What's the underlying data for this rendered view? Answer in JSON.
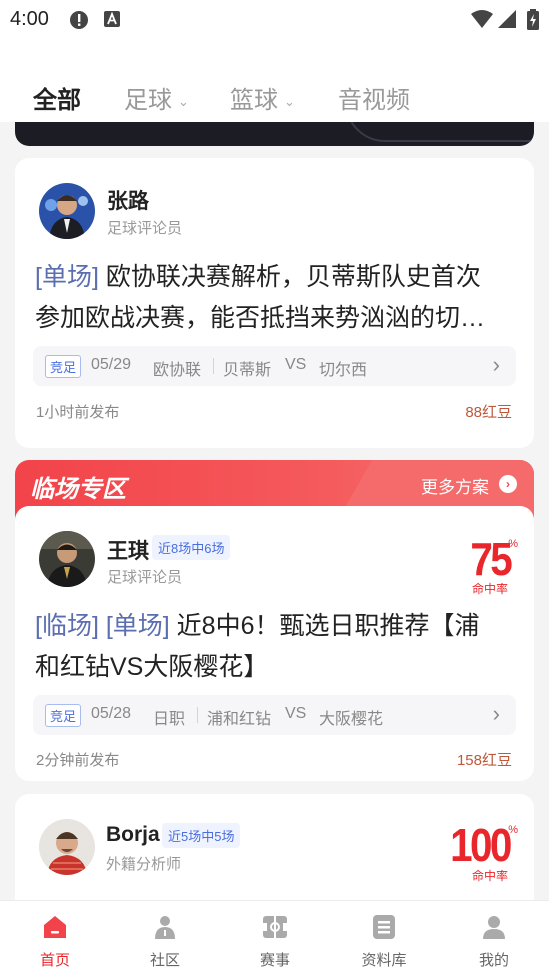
{
  "status_bar": {
    "time": "4:00"
  },
  "tabs": [
    {
      "label": "全部",
      "active": true,
      "has_dropdown": false
    },
    {
      "label": "足球",
      "active": false,
      "has_dropdown": true
    },
    {
      "label": "篮球",
      "active": false,
      "has_dropdown": true
    },
    {
      "label": "音视频",
      "active": false,
      "has_dropdown": false
    }
  ],
  "card1": {
    "name": "张路",
    "role": "足球评论员",
    "headline_tag": "[单场]",
    "headline_line1": " 欧协联决赛解析，贝蒂斯队史首次",
    "headline_line2": "参加欧战决赛，能否抵挡来势汹汹的切…",
    "match": {
      "kind": "竞足",
      "date": "05/29",
      "league": "欧协联",
      "home": "贝蒂斯",
      "vs": "VS",
      "away": "切尔西"
    },
    "posted": "1小时前发布",
    "price": "88红豆"
  },
  "zone": {
    "title": "临场专区",
    "more": "更多方案"
  },
  "card2": {
    "name": "王琪",
    "badge": "近8场中6场",
    "role": "足球评论员",
    "rate": "75",
    "rate_pct": "%",
    "rate_label": "命中率",
    "headline_tag": "[临场] [单场]",
    "headline_line1": " 近8中6！甄选日职推荐【浦",
    "headline_line2": "和红钻VS大阪樱花】",
    "match": {
      "kind": "竞足",
      "date": "05/28",
      "league": "日职",
      "home": "浦和红钻",
      "vs": "VS",
      "away": "大阪樱花"
    },
    "posted": "2分钟前发布",
    "price": "158红豆"
  },
  "card3": {
    "name": "Borja",
    "badge": "近5场中5场",
    "role": "外籍分析师",
    "rate": "100",
    "rate_pct": "%",
    "rate_label": "命中率"
  },
  "bottom_nav": [
    {
      "label": "首页",
      "icon": "home-icon",
      "active": true
    },
    {
      "label": "社区",
      "icon": "community-icon",
      "active": false
    },
    {
      "label": "赛事",
      "icon": "match-icon",
      "active": false
    },
    {
      "label": "资料库",
      "icon": "database-icon",
      "active": false
    },
    {
      "label": "我的",
      "icon": "profile-icon",
      "active": false
    }
  ],
  "colors": {
    "accent": "#e8262b",
    "tag_blue": "#5b6eb0",
    "price": "#c0583a"
  }
}
